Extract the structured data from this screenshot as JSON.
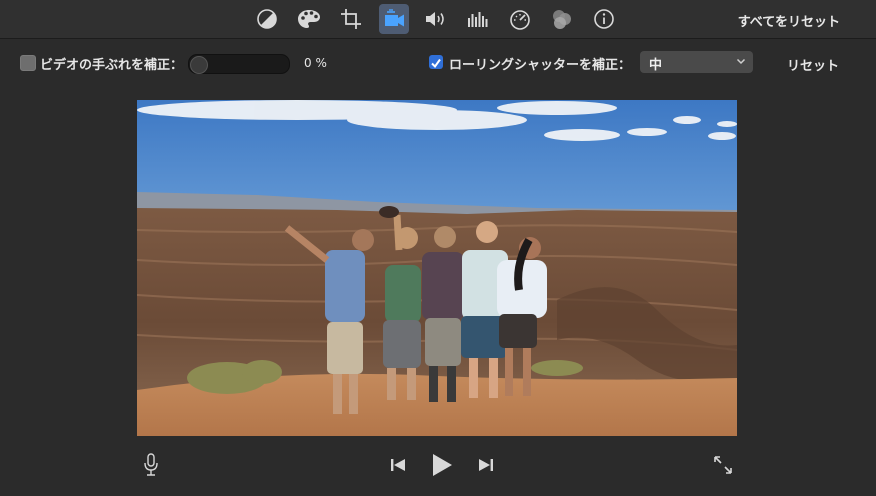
{
  "toolbar": {
    "tools": [
      {
        "name": "color-balance-icon"
      },
      {
        "name": "color-correction-icon"
      },
      {
        "name": "crop-icon"
      },
      {
        "name": "stabilization-icon",
        "active": true
      },
      {
        "name": "volume-icon"
      },
      {
        "name": "noise-reduction-equalizer-icon"
      },
      {
        "name": "speed-icon"
      },
      {
        "name": "clip-filter-icon"
      },
      {
        "name": "info-icon"
      }
    ],
    "reset_all_label": "すべてをリセット"
  },
  "options": {
    "stabilize_label": "ビデオの手ぶれを補正：",
    "stabilize_checked": false,
    "stabilize_value": 0,
    "stabilize_percent_text": "0 %",
    "rolling_shutter_label": "ローリングシャッターを補正：",
    "rolling_shutter_checked": true,
    "rolling_shutter_value": "中",
    "reset_label": "リセット"
  },
  "colors": {
    "accent": "#2f6fd8",
    "active_tool_bg": "#4e5c73",
    "active_tool_icon": "#4aa3ff"
  },
  "viewer": {
    "content": "photo"
  },
  "controls": {
    "icons": [
      "microphone-icon",
      "skip-back-icon",
      "play-icon",
      "skip-forward-icon",
      "fullscreen-icon"
    ]
  }
}
